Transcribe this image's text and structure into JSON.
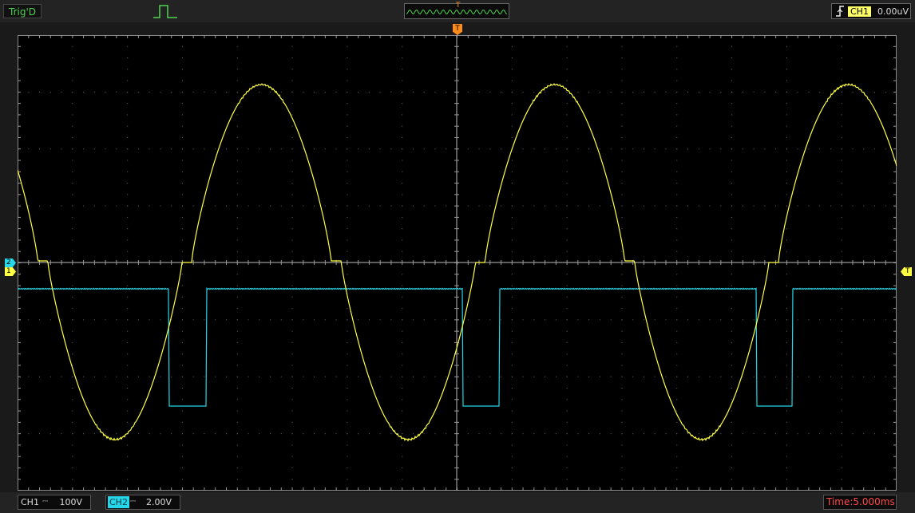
{
  "status": {
    "trigger_state": "Trig'D"
  },
  "trigger": {
    "source": "CH1",
    "level": "0.00uV",
    "position_marker": "T"
  },
  "channels": [
    {
      "name": "CH1",
      "marker": "1",
      "coupling": "⎓",
      "scale": "100V",
      "color": "#ffff44"
    },
    {
      "name": "CH2",
      "marker": "2",
      "coupling": "⎓",
      "scale": "2.00V",
      "color": "#27d6e8"
    }
  ],
  "right_marker": "T",
  "timebase": {
    "label": "Time:5.000ms"
  },
  "icons": {
    "pulse": "pulse-icon",
    "edge": "rising-edge-icon"
  }
}
